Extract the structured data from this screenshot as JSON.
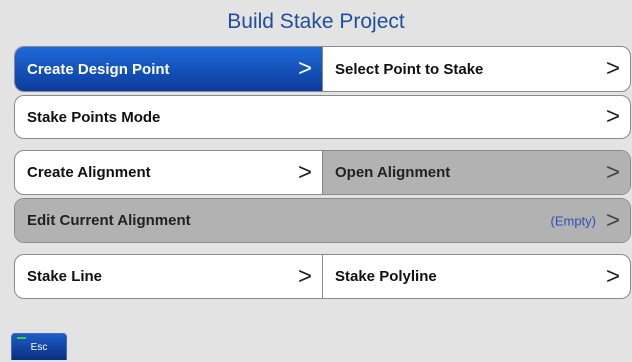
{
  "title": "Build Stake Project",
  "menu": {
    "create_design_point": "Create Design Point",
    "select_point_to_stake": "Select Point to Stake",
    "stake_points_mode": "Stake Points Mode",
    "create_alignment": "Create Alignment",
    "open_alignment": "Open Alignment",
    "edit_current_alignment": "Edit Current Alignment",
    "edit_current_alignment_status": "(Empty)",
    "stake_line": "Stake Line",
    "stake_polyline": "Stake Polyline"
  },
  "arrow_glyph": ">",
  "esc_label": "Esc",
  "colors": {
    "title": "#1f4f9c",
    "active": "#0d4fc4",
    "disabled": "#b2b2b2",
    "background": "#e3e3e3"
  },
  "icons": {
    "arrow": "chevron-right-icon",
    "esc_indicator": "green-led-icon"
  }
}
